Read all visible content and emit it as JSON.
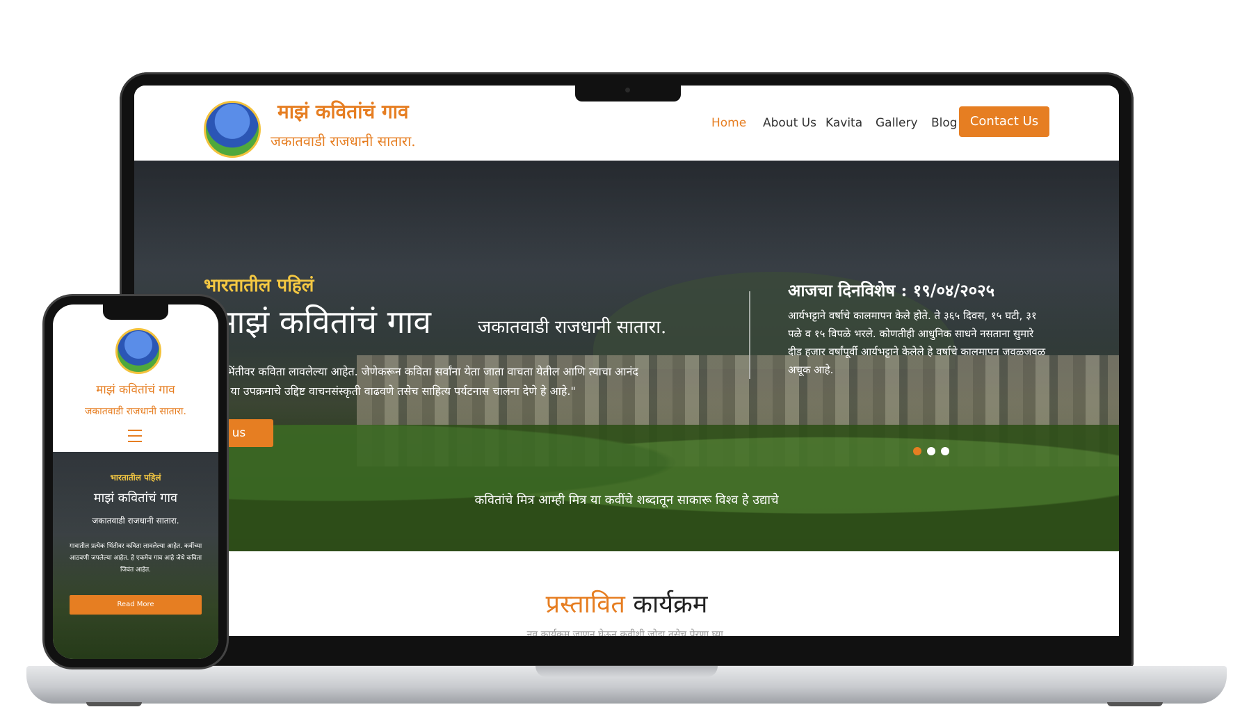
{
  "site": {
    "logo_title": "माझं कवितांचं गाव",
    "logo_subtitle": "जकातवाडी राजधानी सातारा.",
    "nav": [
      "Home",
      "About Us",
      "Kavita",
      "Gallery",
      "Blog"
    ],
    "contact_label": "Contact Us"
  },
  "hero": {
    "kicker": "भारतातील पहिलं",
    "title": "माझं कवितांचं गाव",
    "subtitle": "जकातवाडी राजधानी सातारा.",
    "text": "तील भिंतीवर कविता लावलेल्या आहेत. जेणेकरून कविता सर्वांना येता जाता वाचता येतील आणि त्याचा आनंद घेईल. या उपक्रमाचे उद्दिष्ट वाचनसंस्कृती वाढवणे तसेच साहित्य पर्यटनास चालना देणे हे आहे.\"",
    "join_label": "in us",
    "today_title": "आजचा दिनविशेष : १९/०४/२०२५",
    "today_text": "आर्यभट्टाने वर्षाचे कालमापन केले होते. ते ३६५ दिवस, १५ घटी, ३१ पळे व १५ विपळे भरले. कोणतीही आधुनिक साधने नसताना सुमारे दीड हजार वर्षांपूर्वी आर्यभट्टाने केलेले हे वर्षाचे कालमापन जवळजवळ अचूक आहे.",
    "tagline": "कवितांचे मित्र आम्ही मित्र या कवींचे शब्दातून साकारू विश्व हे उद्याचे"
  },
  "section": {
    "title_accent": "प्रस्तावित",
    "title_rest": "कार्यक्रम",
    "subtitle": "नव कार्यक्रम जाणून घेऊन कवीशी जोडा तसेच प्रेरणा घ्या."
  },
  "phone": {
    "logo_title": "माझं कवितांचं गाव",
    "logo_subtitle": "जकातवाडी राजधानी सातारा.",
    "kicker": "भारतातील पहिलं",
    "title": "माझं कवितांचं गाव",
    "subtitle": "जकातवाडी राजधानी सातारा.",
    "text": "गावातील प्रत्येक भिंतीवर कविता लावलेल्या आहेत. कवींच्या आठवणी जपलेल्या आहेत. हे एकमेव गाव आहे जेथे कविता जिवंत आहेत.",
    "button": "Read More"
  },
  "colors": {
    "accent": "#e67e22",
    "gold": "#f5c842"
  }
}
